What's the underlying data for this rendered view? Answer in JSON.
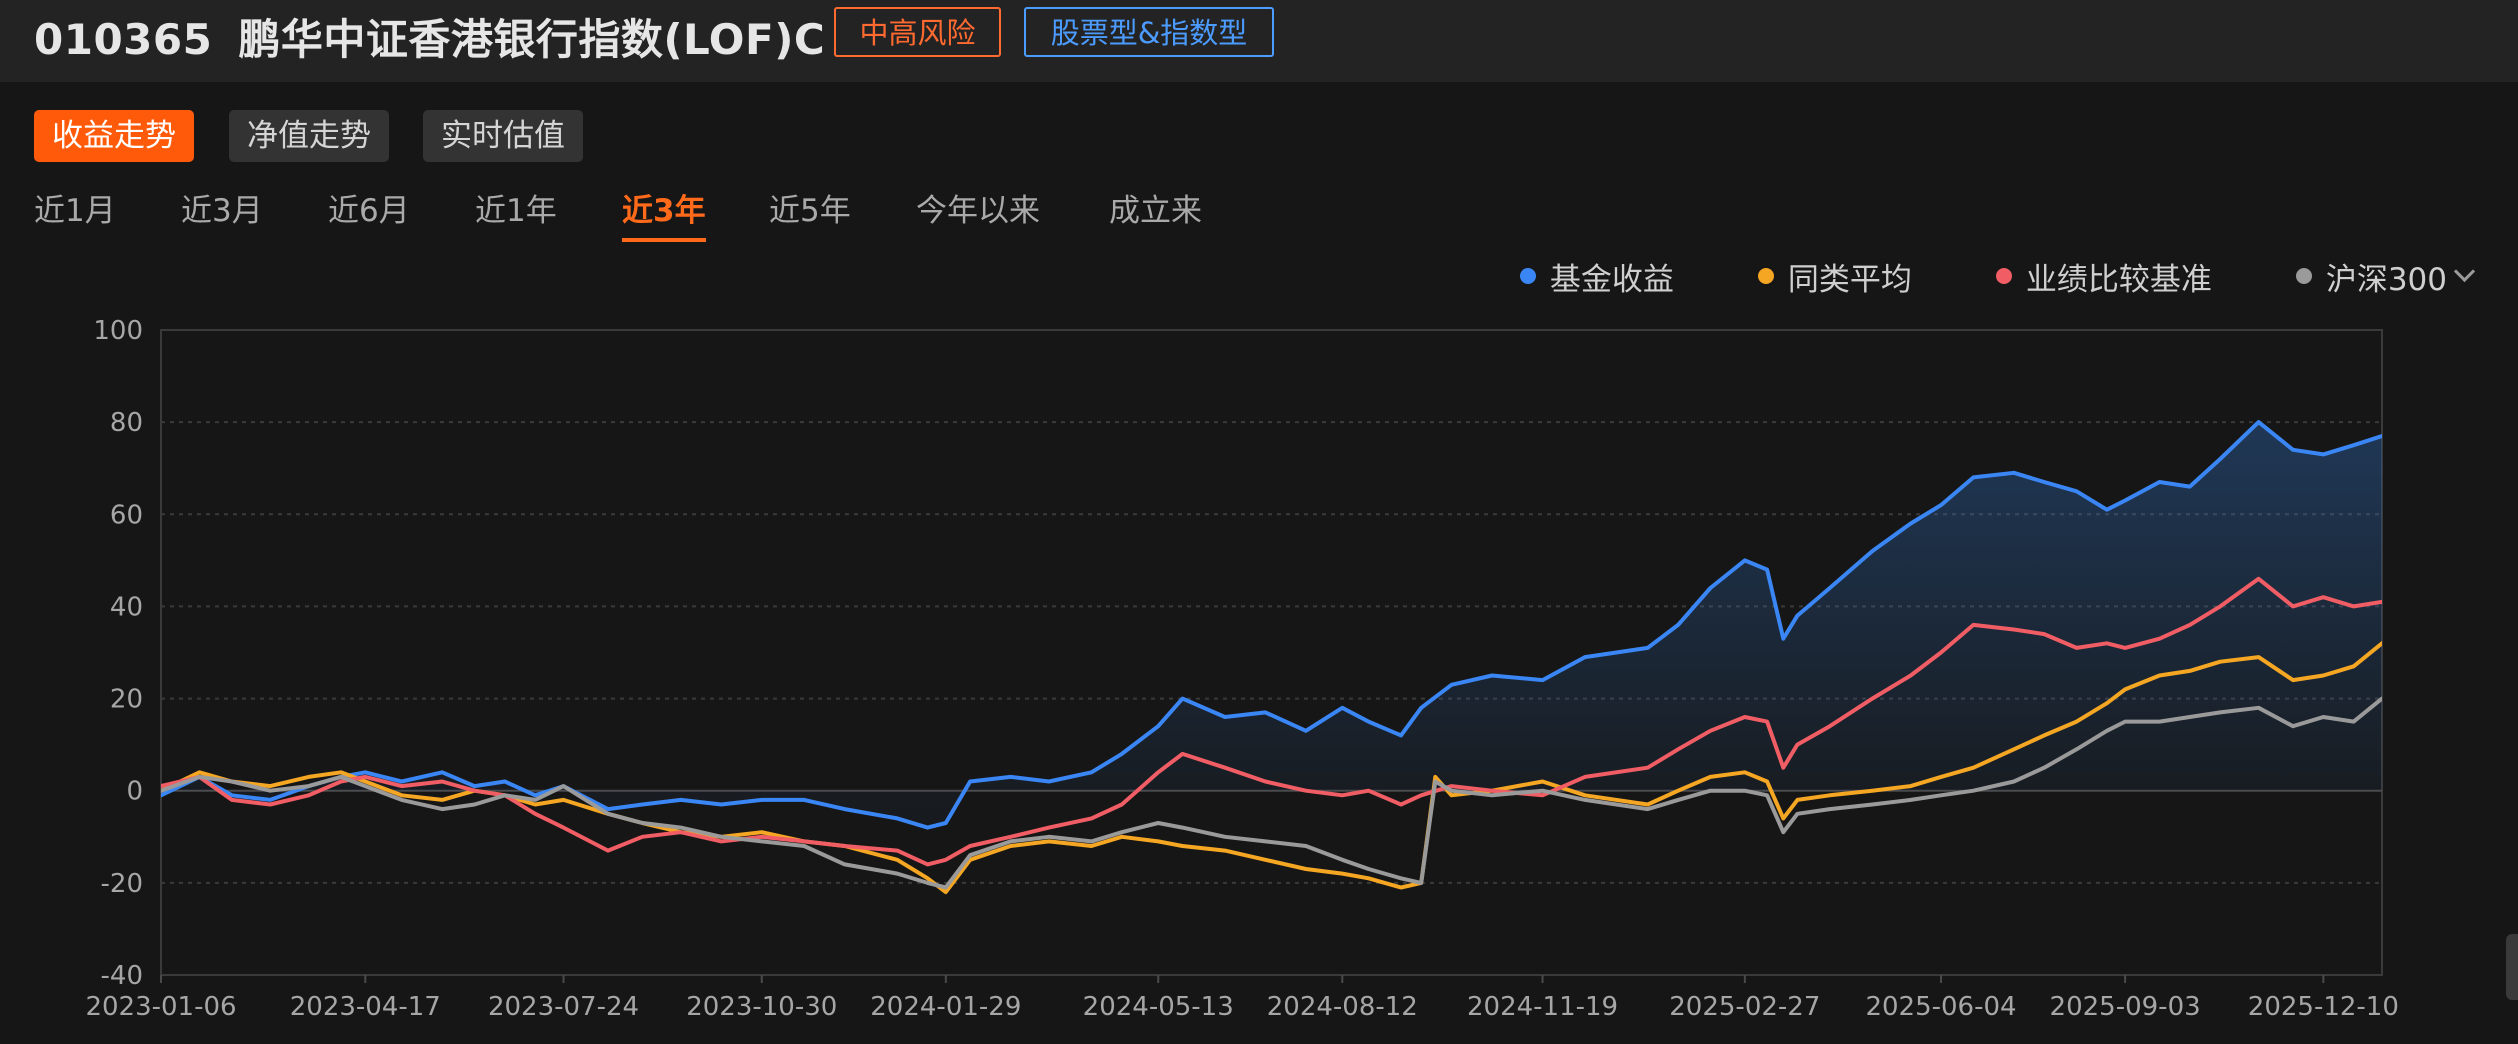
{
  "header": {
    "code": "010365",
    "name": "鹏华中证香港银行指数(LOF)C",
    "risk_tag": "中高风险",
    "type_tag": "股票型&指数型",
    "risk_color": "#ff6a30",
    "type_color": "#4c9bff"
  },
  "mode_tabs": [
    {
      "label": "收益走势",
      "active": true
    },
    {
      "label": "净值走势",
      "active": false
    },
    {
      "label": "实时估值",
      "active": false
    }
  ],
  "periods": [
    {
      "label": "近1月",
      "active": false
    },
    {
      "label": "近3月",
      "active": false
    },
    {
      "label": "近6月",
      "active": false
    },
    {
      "label": "近1年",
      "active": false
    },
    {
      "label": "近3年",
      "active": true
    },
    {
      "label": "近5年",
      "active": false
    },
    {
      "label": "今年以来",
      "active": false
    },
    {
      "label": "成立来",
      "active": false
    }
  ],
  "legend": {
    "more_icon": "chevron-down-icon"
  },
  "chart_data": {
    "type": "line",
    "xlabel": "",
    "ylabel": "",
    "ylim": [
      -40,
      100
    ],
    "yticks": [
      -40,
      -20,
      0,
      20,
      40,
      60,
      80,
      100
    ],
    "xticks": [
      "2023-01-06",
      "2023-04-17",
      "2023-07-24",
      "2023-10-30",
      "2024-01-29",
      "2024-05-13",
      "2024-08-12",
      "2024-11-19",
      "2025-02-27",
      "2025-06-04",
      "2025-09-03",
      "2025-12-10"
    ],
    "xrange": [
      "2023-01-06",
      "2026-01-08"
    ],
    "grid": "dashed horizontal",
    "legend_position": "top-right",
    "series": [
      {
        "name": "基金收益",
        "color": "#3a86f5",
        "area": true,
        "points": [
          [
            "2023-01-06",
            -1
          ],
          [
            "2023-01-25",
            3
          ],
          [
            "2023-02-10",
            -1
          ],
          [
            "2023-03-01",
            -2
          ],
          [
            "2023-03-20",
            1
          ],
          [
            "2023-04-05",
            3
          ],
          [
            "2023-04-17",
            4
          ],
          [
            "2023-05-05",
            2
          ],
          [
            "2023-05-25",
            4
          ],
          [
            "2023-06-10",
            1
          ],
          [
            "2023-06-25",
            2
          ],
          [
            "2023-07-10",
            -1
          ],
          [
            "2023-07-24",
            1
          ],
          [
            "2023-08-15",
            -4
          ],
          [
            "2023-09-01",
            -3
          ],
          [
            "2023-09-20",
            -2
          ],
          [
            "2023-10-10",
            -3
          ],
          [
            "2023-10-30",
            -2
          ],
          [
            "2023-11-20",
            -2
          ],
          [
            "2023-12-10",
            -4
          ],
          [
            "2024-01-05",
            -6
          ],
          [
            "2024-01-20",
            -8
          ],
          [
            "2024-01-29",
            -7
          ],
          [
            "2024-02-10",
            2
          ],
          [
            "2024-03-01",
            3
          ],
          [
            "2024-03-20",
            2
          ],
          [
            "2024-04-10",
            4
          ],
          [
            "2024-04-25",
            8
          ],
          [
            "2024-05-13",
            14
          ],
          [
            "2024-05-25",
            20
          ],
          [
            "2024-06-15",
            16
          ],
          [
            "2024-07-05",
            17
          ],
          [
            "2024-07-25",
            13
          ],
          [
            "2024-08-12",
            18
          ],
          [
            "2024-08-25",
            15
          ],
          [
            "2024-09-10",
            12
          ],
          [
            "2024-09-20",
            18
          ],
          [
            "2024-10-05",
            23
          ],
          [
            "2024-10-25",
            25
          ],
          [
            "2024-11-19",
            24
          ],
          [
            "2024-12-10",
            29
          ],
          [
            "2025-01-10",
            31
          ],
          [
            "2025-01-25",
            36
          ],
          [
            "2025-02-10",
            44
          ],
          [
            "2025-02-27",
            50
          ],
          [
            "2025-03-10",
            48
          ],
          [
            "2025-03-18",
            33
          ],
          [
            "2025-03-25",
            38
          ],
          [
            "2025-04-10",
            44
          ],
          [
            "2025-05-01",
            52
          ],
          [
            "2025-05-20",
            58
          ],
          [
            "2025-06-04",
            62
          ],
          [
            "2025-06-20",
            68
          ],
          [
            "2025-07-10",
            69
          ],
          [
            "2025-07-25",
            67
          ],
          [
            "2025-08-10",
            65
          ],
          [
            "2025-08-25",
            61
          ],
          [
            "2025-09-03",
            63
          ],
          [
            "2025-09-20",
            67
          ],
          [
            "2025-10-05",
            66
          ],
          [
            "2025-10-20",
            72
          ],
          [
            "2025-11-08",
            80
          ],
          [
            "2025-11-25",
            74
          ],
          [
            "2025-12-10",
            73
          ],
          [
            "2025-12-25",
            75
          ],
          [
            "2026-01-08",
            77
          ]
        ]
      },
      {
        "name": "同类平均",
        "color": "#f5a623",
        "area": false,
        "points": [
          [
            "2023-01-06",
            0
          ],
          [
            "2023-01-25",
            4
          ],
          [
            "2023-02-10",
            2
          ],
          [
            "2023-03-01",
            1
          ],
          [
            "2023-03-20",
            3
          ],
          [
            "2023-04-05",
            4
          ],
          [
            "2023-04-17",
            2
          ],
          [
            "2023-05-05",
            -1
          ],
          [
            "2023-05-25",
            -2
          ],
          [
            "2023-06-10",
            0
          ],
          [
            "2023-06-25",
            -1
          ],
          [
            "2023-07-10",
            -3
          ],
          [
            "2023-07-24",
            -2
          ],
          [
            "2023-08-15",
            -5
          ],
          [
            "2023-09-01",
            -7
          ],
          [
            "2023-09-20",
            -9
          ],
          [
            "2023-10-10",
            -10
          ],
          [
            "2023-10-30",
            -9
          ],
          [
            "2023-11-20",
            -11
          ],
          [
            "2023-12-10",
            -12
          ],
          [
            "2024-01-05",
            -15
          ],
          [
            "2024-01-20",
            -19
          ],
          [
            "2024-01-29",
            -22
          ],
          [
            "2024-02-10",
            -15
          ],
          [
            "2024-03-01",
            -12
          ],
          [
            "2024-03-20",
            -11
          ],
          [
            "2024-04-10",
            -12
          ],
          [
            "2024-04-25",
            -10
          ],
          [
            "2024-05-13",
            -11
          ],
          [
            "2024-05-25",
            -12
          ],
          [
            "2024-06-15",
            -13
          ],
          [
            "2024-07-05",
            -15
          ],
          [
            "2024-07-25",
            -17
          ],
          [
            "2024-08-12",
            -18
          ],
          [
            "2024-08-25",
            -19
          ],
          [
            "2024-09-10",
            -21
          ],
          [
            "2024-09-20",
            -20
          ],
          [
            "2024-09-27",
            3
          ],
          [
            "2024-10-05",
            -1
          ],
          [
            "2024-10-25",
            0
          ],
          [
            "2024-11-19",
            2
          ],
          [
            "2024-12-10",
            -1
          ],
          [
            "2025-01-10",
            -3
          ],
          [
            "2025-01-25",
            0
          ],
          [
            "2025-02-10",
            3
          ],
          [
            "2025-02-27",
            4
          ],
          [
            "2025-03-10",
            2
          ],
          [
            "2025-03-18",
            -6
          ],
          [
            "2025-03-25",
            -2
          ],
          [
            "2025-04-10",
            -1
          ],
          [
            "2025-05-01",
            0
          ],
          [
            "2025-05-20",
            1
          ],
          [
            "2025-06-04",
            3
          ],
          [
            "2025-06-20",
            5
          ],
          [
            "2025-07-10",
            9
          ],
          [
            "2025-07-25",
            12
          ],
          [
            "2025-08-10",
            15
          ],
          [
            "2025-08-25",
            19
          ],
          [
            "2025-09-03",
            22
          ],
          [
            "2025-09-20",
            25
          ],
          [
            "2025-10-05",
            26
          ],
          [
            "2025-10-20",
            28
          ],
          [
            "2025-11-08",
            29
          ],
          [
            "2025-11-25",
            24
          ],
          [
            "2025-12-10",
            25
          ],
          [
            "2025-12-25",
            27
          ],
          [
            "2026-01-08",
            32
          ]
        ]
      },
      {
        "name": "业绩比较基准",
        "color": "#f05d64",
        "area": false,
        "points": [
          [
            "2023-01-06",
            1
          ],
          [
            "2023-01-25",
            3
          ],
          [
            "2023-02-10",
            -2
          ],
          [
            "2023-03-01",
            -3
          ],
          [
            "2023-03-20",
            -1
          ],
          [
            "2023-04-05",
            2
          ],
          [
            "2023-04-17",
            3
          ],
          [
            "2023-05-05",
            1
          ],
          [
            "2023-05-25",
            2
          ],
          [
            "2023-06-10",
            0
          ],
          [
            "2023-06-25",
            -1
          ],
          [
            "2023-07-10",
            -5
          ],
          [
            "2023-07-24",
            -8
          ],
          [
            "2023-08-15",
            -13
          ],
          [
            "2023-09-01",
            -10
          ],
          [
            "2023-09-20",
            -9
          ],
          [
            "2023-10-10",
            -11
          ],
          [
            "2023-10-30",
            -10
          ],
          [
            "2023-11-20",
            -11
          ],
          [
            "2023-12-10",
            -12
          ],
          [
            "2024-01-05",
            -13
          ],
          [
            "2024-01-20",
            -16
          ],
          [
            "2024-01-29",
            -15
          ],
          [
            "2024-02-10",
            -12
          ],
          [
            "2024-03-01",
            -10
          ],
          [
            "2024-03-20",
            -8
          ],
          [
            "2024-04-10",
            -6
          ],
          [
            "2024-04-25",
            -3
          ],
          [
            "2024-05-13",
            4
          ],
          [
            "2024-05-25",
            8
          ],
          [
            "2024-06-15",
            5
          ],
          [
            "2024-07-05",
            2
          ],
          [
            "2024-07-25",
            0
          ],
          [
            "2024-08-12",
            -1
          ],
          [
            "2024-08-25",
            0
          ],
          [
            "2024-09-10",
            -3
          ],
          [
            "2024-09-20",
            -1
          ],
          [
            "2024-10-05",
            1
          ],
          [
            "2024-10-25",
            0
          ],
          [
            "2024-11-19",
            -1
          ],
          [
            "2024-12-10",
            3
          ],
          [
            "2025-01-10",
            5
          ],
          [
            "2025-01-25",
            9
          ],
          [
            "2025-02-10",
            13
          ],
          [
            "2025-02-27",
            16
          ],
          [
            "2025-03-10",
            15
          ],
          [
            "2025-03-18",
            5
          ],
          [
            "2025-03-25",
            10
          ],
          [
            "2025-04-10",
            14
          ],
          [
            "2025-05-01",
            20
          ],
          [
            "2025-05-20",
            25
          ],
          [
            "2025-06-04",
            30
          ],
          [
            "2025-06-20",
            36
          ],
          [
            "2025-07-10",
            35
          ],
          [
            "2025-07-25",
            34
          ],
          [
            "2025-08-10",
            31
          ],
          [
            "2025-08-25",
            32
          ],
          [
            "2025-09-03",
            31
          ],
          [
            "2025-09-20",
            33
          ],
          [
            "2025-10-05",
            36
          ],
          [
            "2025-10-20",
            40
          ],
          [
            "2025-11-08",
            46
          ],
          [
            "2025-11-25",
            40
          ],
          [
            "2025-12-10",
            42
          ],
          [
            "2025-12-25",
            40
          ],
          [
            "2026-01-08",
            41
          ]
        ]
      },
      {
        "name": "沪深300",
        "color": "#9a9a9a",
        "area": false,
        "points": [
          [
            "2023-01-06",
            0
          ],
          [
            "2023-01-25",
            3
          ],
          [
            "2023-02-10",
            2
          ],
          [
            "2023-03-01",
            0
          ],
          [
            "2023-03-20",
            1
          ],
          [
            "2023-04-05",
            3
          ],
          [
            "2023-04-17",
            1
          ],
          [
            "2023-05-05",
            -2
          ],
          [
            "2023-05-25",
            -4
          ],
          [
            "2023-06-10",
            -3
          ],
          [
            "2023-06-25",
            -1
          ],
          [
            "2023-07-10",
            -2
          ],
          [
            "2023-07-24",
            1
          ],
          [
            "2023-08-15",
            -5
          ],
          [
            "2023-09-01",
            -7
          ],
          [
            "2023-09-20",
            -8
          ],
          [
            "2023-10-10",
            -10
          ],
          [
            "2023-10-30",
            -11
          ],
          [
            "2023-11-20",
            -12
          ],
          [
            "2023-12-10",
            -16
          ],
          [
            "2024-01-05",
            -18
          ],
          [
            "2024-01-20",
            -20
          ],
          [
            "2024-01-29",
            -21
          ],
          [
            "2024-02-10",
            -14
          ],
          [
            "2024-03-01",
            -11
          ],
          [
            "2024-03-20",
            -10
          ],
          [
            "2024-04-10",
            -11
          ],
          [
            "2024-04-25",
            -9
          ],
          [
            "2024-05-13",
            -7
          ],
          [
            "2024-05-25",
            -8
          ],
          [
            "2024-06-15",
            -10
          ],
          [
            "2024-07-05",
            -11
          ],
          [
            "2024-07-25",
            -12
          ],
          [
            "2024-08-12",
            -15
          ],
          [
            "2024-08-25",
            -17
          ],
          [
            "2024-09-10",
            -19
          ],
          [
            "2024-09-20",
            -20
          ],
          [
            "2024-09-27",
            2
          ],
          [
            "2024-10-05",
            0
          ],
          [
            "2024-10-25",
            -1
          ],
          [
            "2024-11-19",
            0
          ],
          [
            "2024-12-10",
            -2
          ],
          [
            "2025-01-10",
            -4
          ],
          [
            "2025-01-25",
            -2
          ],
          [
            "2025-02-10",
            0
          ],
          [
            "2025-02-27",
            0
          ],
          [
            "2025-03-10",
            -1
          ],
          [
            "2025-03-18",
            -9
          ],
          [
            "2025-03-25",
            -5
          ],
          [
            "2025-04-10",
            -4
          ],
          [
            "2025-05-01",
            -3
          ],
          [
            "2025-05-20",
            -2
          ],
          [
            "2025-06-04",
            -1
          ],
          [
            "2025-06-20",
            0
          ],
          [
            "2025-07-10",
            2
          ],
          [
            "2025-07-25",
            5
          ],
          [
            "2025-08-10",
            9
          ],
          [
            "2025-08-25",
            13
          ],
          [
            "2025-09-03",
            15
          ],
          [
            "2025-09-20",
            15
          ],
          [
            "2025-10-05",
            16
          ],
          [
            "2025-10-20",
            17
          ],
          [
            "2025-11-08",
            18
          ],
          [
            "2025-11-25",
            14
          ],
          [
            "2025-12-10",
            16
          ],
          [
            "2025-12-25",
            15
          ],
          [
            "2026-01-08",
            20
          ]
        ]
      }
    ]
  }
}
